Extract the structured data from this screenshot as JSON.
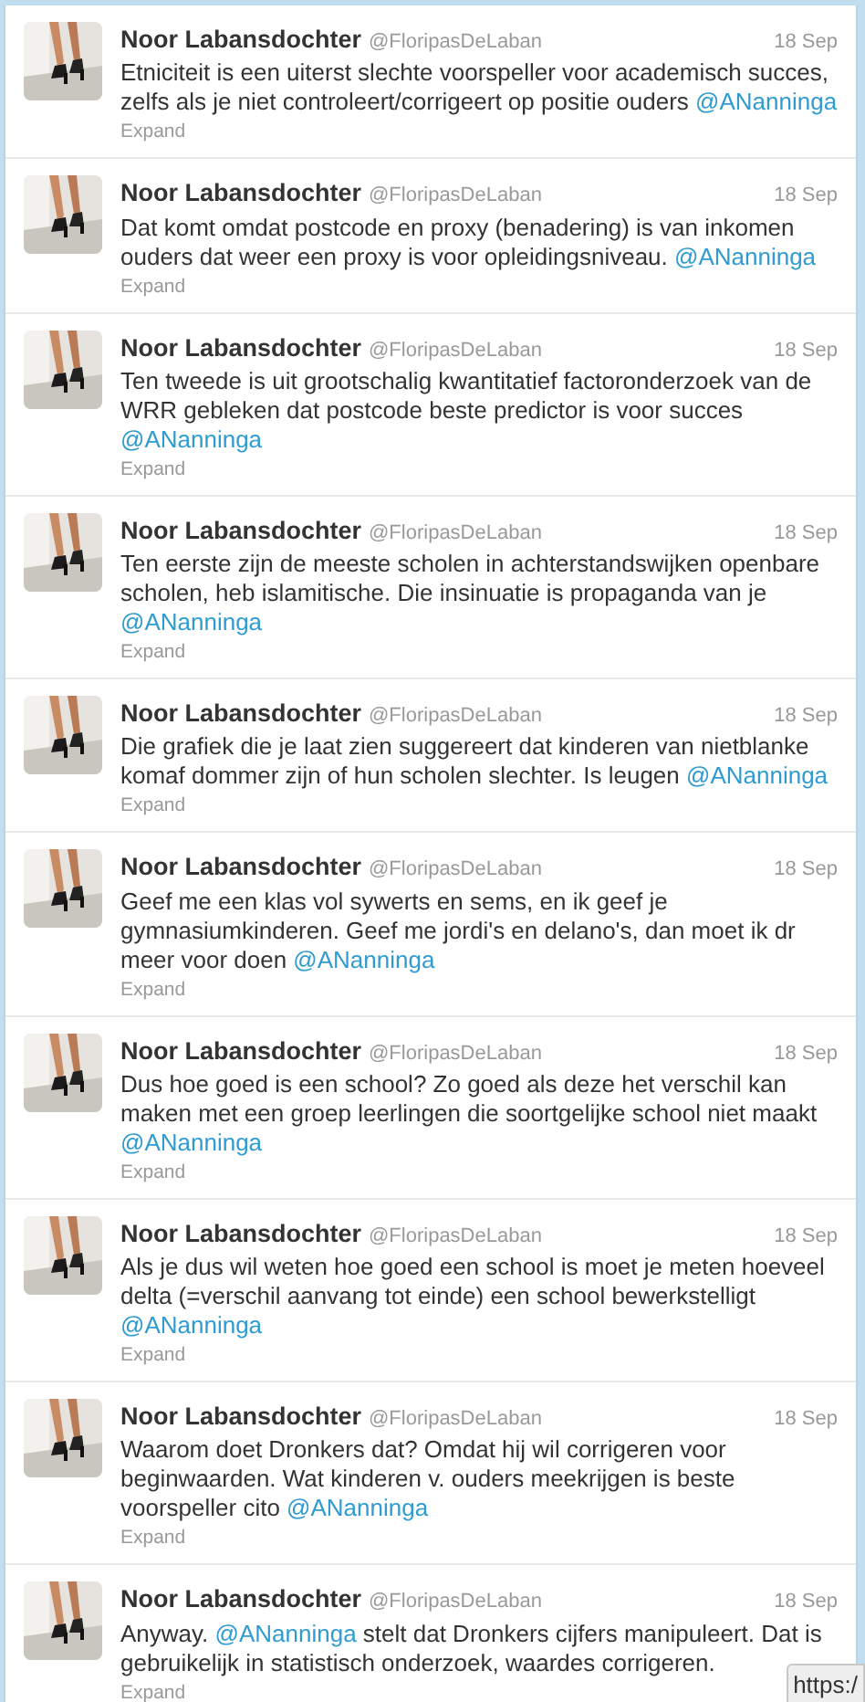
{
  "tweets": [
    {
      "name": "Noor Labansdochter",
      "handle": "@FloripasDeLaban",
      "date": "18 Sep",
      "body": [
        {
          "kind": "text",
          "text": "Etniciteit is een uiterst slechte voorspeller voor academisch succes, zelfs als je niet controleert/corrigeert op positie ouders "
        },
        {
          "kind": "mention",
          "text": "@ANanninga"
        }
      ],
      "expand": "Expand"
    },
    {
      "name": "Noor Labansdochter",
      "handle": "@FloripasDeLaban",
      "date": "18 Sep",
      "body": [
        {
          "kind": "text",
          "text": "Dat komt omdat postcode en proxy (benadering) is van inkomen ouders dat weer een proxy is voor opleidingsniveau. "
        },
        {
          "kind": "mention",
          "text": "@ANanninga"
        }
      ],
      "expand": "Expand"
    },
    {
      "name": "Noor Labansdochter",
      "handle": "@FloripasDeLaban",
      "date": "18 Sep",
      "body": [
        {
          "kind": "text",
          "text": "Ten tweede is uit grootschalig kwantitatief factoronderzoek van de WRR gebleken dat postcode beste predictor is voor succes "
        },
        {
          "kind": "mention",
          "text": "@ANanninga"
        }
      ],
      "expand": "Expand"
    },
    {
      "name": "Noor Labansdochter",
      "handle": "@FloripasDeLaban",
      "date": "18 Sep",
      "body": [
        {
          "kind": "text",
          "text": "Ten eerste zijn de meeste scholen in achterstandswijken openbare scholen, heb islamitische. Die insinuatie is propaganda van je "
        },
        {
          "kind": "mention",
          "text": "@ANanninga"
        }
      ],
      "expand": "Expand"
    },
    {
      "name": "Noor Labansdochter",
      "handle": "@FloripasDeLaban",
      "date": "18 Sep",
      "body": [
        {
          "kind": "text",
          "text": "Die grafiek die je laat zien suggereert dat kinderen van nietblanke komaf dommer zijn of hun scholen slechter. Is leugen "
        },
        {
          "kind": "mention",
          "text": "@ANanninga"
        }
      ],
      "expand": "Expand"
    },
    {
      "name": "Noor Labansdochter",
      "handle": "@FloripasDeLaban",
      "date": "18 Sep",
      "body": [
        {
          "kind": "text",
          "text": "Geef me een klas vol sywerts en sems, en ik geef je gymnasiumkinderen. Geef me jordi's en delano's, dan moet ik dr meer voor doen "
        },
        {
          "kind": "mention",
          "text": "@ANanninga"
        }
      ],
      "expand": "Expand"
    },
    {
      "name": "Noor Labansdochter",
      "handle": "@FloripasDeLaban",
      "date": "18 Sep",
      "body": [
        {
          "kind": "text",
          "text": "Dus hoe goed is een school? Zo goed als deze het verschil kan maken met een groep leerlingen die soortgelijke school niet maakt "
        },
        {
          "kind": "mention",
          "text": "@ANanninga"
        }
      ],
      "expand": "Expand"
    },
    {
      "name": "Noor Labansdochter",
      "handle": "@FloripasDeLaban",
      "date": "18 Sep",
      "body": [
        {
          "kind": "text",
          "text": "Als je dus wil weten hoe goed een school is moet je meten hoeveel delta (=verschil aanvang tot einde) een school bewerkstelligt "
        },
        {
          "kind": "mention",
          "text": "@ANanninga"
        }
      ],
      "expand": "Expand"
    },
    {
      "name": "Noor Labansdochter",
      "handle": "@FloripasDeLaban",
      "date": "18 Sep",
      "body": [
        {
          "kind": "text",
          "text": "Waarom doet Dronkers dat? Omdat hij wil corrigeren voor beginwaarden. Wat kinderen v. ouders meekrijgen is beste voorspeller cito "
        },
        {
          "kind": "mention",
          "text": "@ANanninga"
        }
      ],
      "expand": "Expand"
    },
    {
      "name": "Noor Labansdochter",
      "handle": "@FloripasDeLaban",
      "date": "18 Sep",
      "body": [
        {
          "kind": "text",
          "text": "Anyway. "
        },
        {
          "kind": "mention",
          "text": "@ANanninga"
        },
        {
          "kind": "text",
          "text": " stelt dat Dronkers cijfers manipuleert. Dat is gebruikelijk in statistisch onderzoek, waardes corrigeren."
        }
      ],
      "expand": "Expand"
    }
  ],
  "status_url": "https:/"
}
